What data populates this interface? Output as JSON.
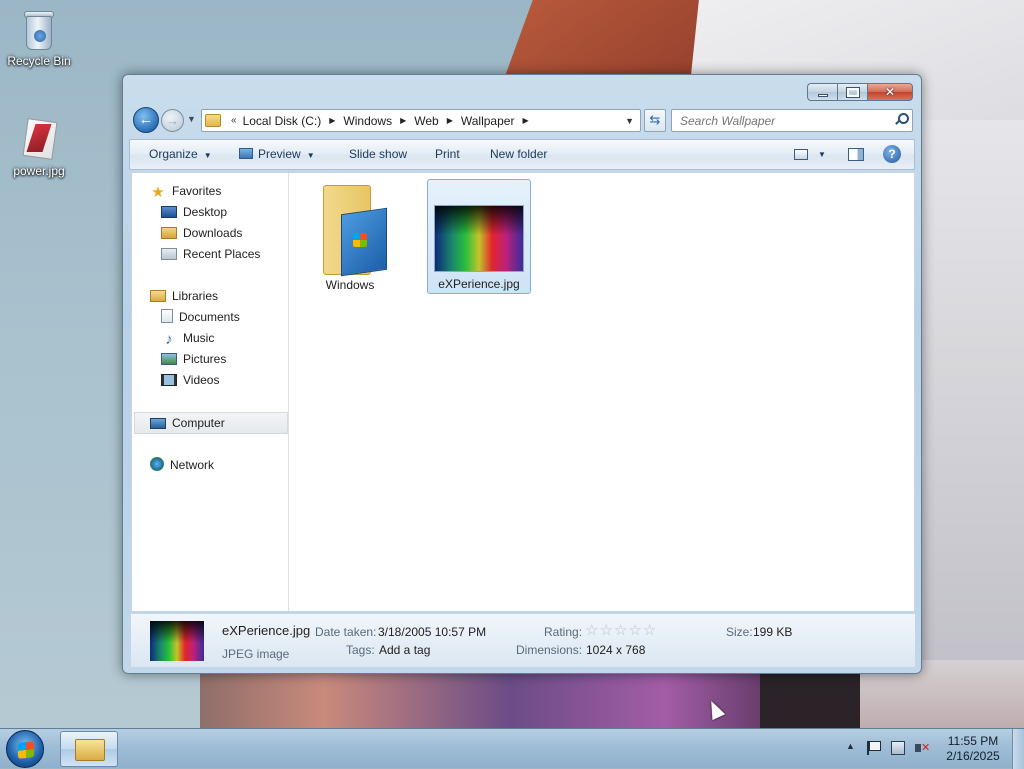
{
  "desktop": {
    "icons": [
      {
        "label": "Recycle Bin",
        "icon": "recycle-bin-icon"
      },
      {
        "label": "power.jpg",
        "icon": "image-file-icon"
      }
    ]
  },
  "window": {
    "title": "",
    "controls": {
      "minimize": "minimize",
      "maximize": "maximize",
      "close": "close"
    }
  },
  "address_bar": {
    "overflow": "«",
    "crumbs": [
      "Local Disk (C:)",
      "Windows",
      "Web",
      "Wallpaper"
    ]
  },
  "search": {
    "placeholder": "Search Wallpaper"
  },
  "toolbar": {
    "organize": "Organize",
    "preview": "Preview",
    "slideshow": "Slide show",
    "print": "Print",
    "new_folder": "New folder"
  },
  "nav_pane": {
    "favorites": {
      "label": "Favorites",
      "items": [
        "Desktop",
        "Downloads",
        "Recent Places"
      ]
    },
    "libraries": {
      "label": "Libraries",
      "items": [
        "Documents",
        "Music",
        "Pictures",
        "Videos"
      ]
    },
    "computer": "Computer",
    "network": "Network"
  },
  "files": [
    {
      "name": "Windows",
      "type": "folder",
      "selected": false
    },
    {
      "name": "eXPerience.jpg",
      "type": "image",
      "selected": true
    }
  ],
  "details": {
    "filename": "eXPerience.jpg",
    "filetype": "JPEG image",
    "date_taken_label": "Date taken:",
    "date_taken": "3/18/2005 10:57 PM",
    "tags_label": "Tags:",
    "tags": "Add a tag",
    "rating_label": "Rating:",
    "rating": 0,
    "rating_max": 5,
    "dimensions_label": "Dimensions:",
    "dimensions": "1024 x 768",
    "size_label": "Size:",
    "size": "199 KB"
  },
  "taskbar": {
    "time": "11:55 PM",
    "date": "2/16/2025"
  }
}
